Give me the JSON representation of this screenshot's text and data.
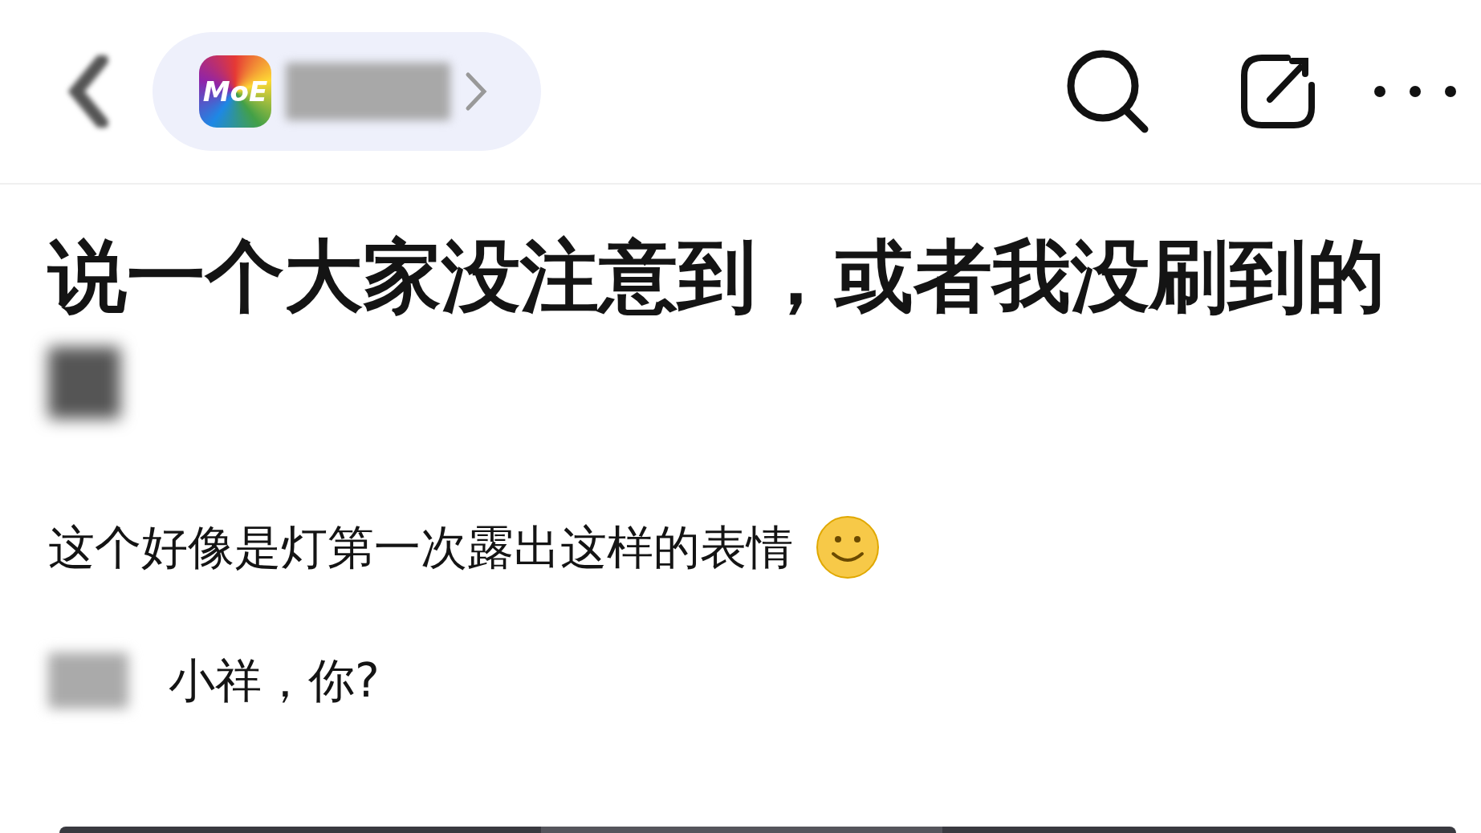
{
  "header": {
    "logo_text": "MoE"
  },
  "post": {
    "title": "说一个大家没注意到，或者我没刷到的",
    "body": "这个好像是灯第一次露出这样的表情",
    "dialogue": [
      {
        "line": "小祥，你?"
      }
    ]
  }
}
